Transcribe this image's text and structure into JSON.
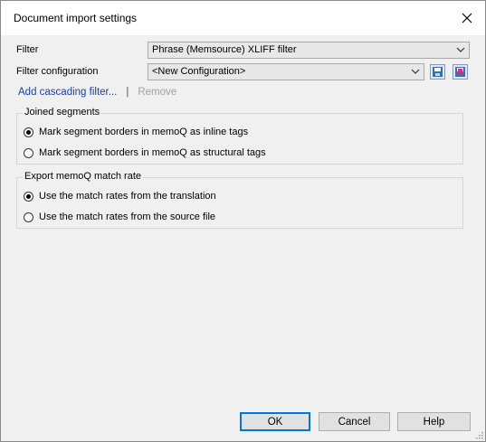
{
  "dialog": {
    "title": "Document import settings"
  },
  "filter": {
    "label": "Filter",
    "value": "Phrase (Memsource) XLIFF filter"
  },
  "filter_config": {
    "label": "Filter configuration",
    "value": "<New Configuration>"
  },
  "cascading": {
    "add_label": "Add cascading filter...",
    "separator": "|",
    "remove_label": "Remove"
  },
  "joined_segments": {
    "legend": "Joined segments",
    "options": [
      {
        "label": "Mark segment borders in memoQ as inline tags",
        "checked": true
      },
      {
        "label": "Mark segment borders in memoQ as structural tags",
        "checked": false
      }
    ]
  },
  "match_rate": {
    "legend": "Export memoQ match rate",
    "options": [
      {
        "label": "Use the match rates from the translation",
        "checked": true
      },
      {
        "label": "Use the match rates from the source file",
        "checked": false
      }
    ]
  },
  "buttons": {
    "ok": "OK",
    "cancel": "Cancel",
    "help": "Help"
  },
  "icons": {
    "close": "close-icon",
    "save": "save-icon",
    "save_as": "save-as-icon",
    "dropdown": "chevron-down-icon"
  },
  "colors": {
    "link": "#1a3ea8",
    "default_button_border": "#0078d7"
  }
}
